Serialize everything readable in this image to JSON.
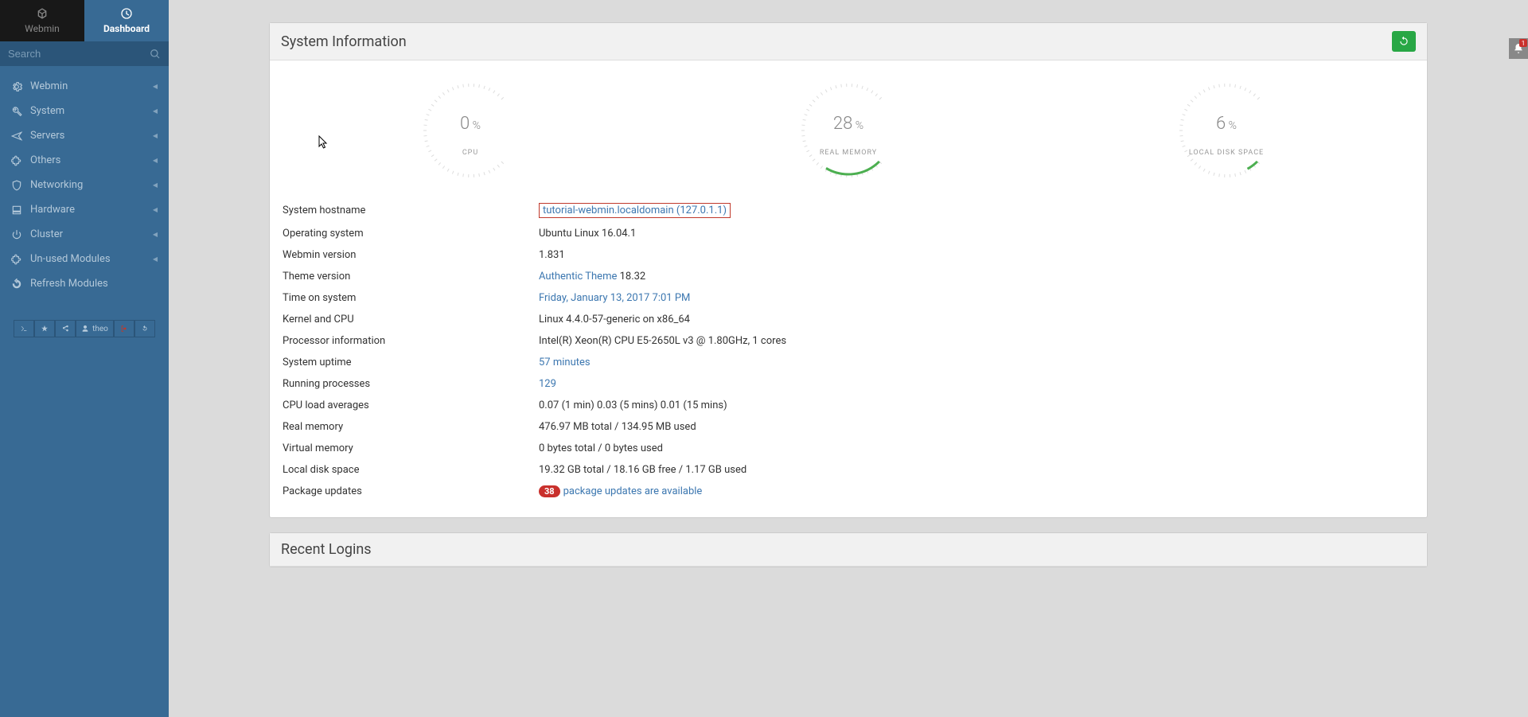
{
  "tabs": {
    "webmin": "Webmin",
    "dashboard": "Dashboard"
  },
  "search": {
    "placeholder": "Search"
  },
  "nav": [
    {
      "label": "Webmin",
      "icon": "gear"
    },
    {
      "label": "System",
      "icon": "wrench"
    },
    {
      "label": "Servers",
      "icon": "plane"
    },
    {
      "label": "Others",
      "icon": "puzzle"
    },
    {
      "label": "Networking",
      "icon": "shield"
    },
    {
      "label": "Hardware",
      "icon": "disk"
    },
    {
      "label": "Cluster",
      "icon": "power"
    },
    {
      "label": "Un-used Modules",
      "icon": "puzzle"
    },
    {
      "label": "Refresh Modules",
      "icon": "refresh",
      "expandable": false
    }
  ],
  "user": "theo",
  "panel_title": "System Information",
  "gauges": {
    "cpu": {
      "value": 0,
      "label": "CPU"
    },
    "mem": {
      "value": 28,
      "label": "REAL MEMORY"
    },
    "disk": {
      "value": 6,
      "label": "LOCAL DISK SPACE"
    }
  },
  "info": {
    "hostname_label": "System hostname",
    "hostname_value": "tutorial-webmin.localdomain (127.0.1.1)",
    "os_label": "Operating system",
    "os_value": "Ubuntu Linux 16.04.1",
    "webminver_label": "Webmin version",
    "webminver_value": "1.831",
    "themever_label": "Theme version",
    "themever_link": "Authentic Theme",
    "themever_value": " 18.32",
    "time_label": "Time on system",
    "time_value": "Friday, January 13, 2017 7:01 PM",
    "kernel_label": "Kernel and CPU",
    "kernel_value": "Linux 4.4.0-57-generic on x86_64",
    "proc_label": "Processor information",
    "proc_value": "Intel(R) Xeon(R) CPU E5-2650L v3 @ 1.80GHz, 1 cores",
    "uptime_label": "System uptime",
    "uptime_value": "57 minutes",
    "procs_label": "Running processes",
    "procs_value": "129",
    "load_label": "CPU load averages",
    "load_value": "0.07 (1 min) 0.03 (5 mins) 0.01 (15 mins)",
    "realmem_label": "Real memory",
    "realmem_value": "476.97 MB total / 134.95 MB used",
    "virtmem_label": "Virtual memory",
    "virtmem_value": "0 bytes total / 0 bytes used",
    "localdisk_label": "Local disk space",
    "localdisk_value": "19.32 GB total / 18.16 GB free / 1.17 GB used",
    "pkg_label": "Package updates",
    "pkg_count": "38",
    "pkg_text": "package updates are available"
  },
  "recent_logins_title": "Recent Logins",
  "notif_count": "1",
  "chart_data": {
    "type": "gauge",
    "series": [
      {
        "name": "CPU",
        "value": 0,
        "unit": "%",
        "range": [
          0,
          100
        ]
      },
      {
        "name": "REAL MEMORY",
        "value": 28,
        "unit": "%",
        "range": [
          0,
          100
        ]
      },
      {
        "name": "LOCAL DISK SPACE",
        "value": 6,
        "unit": "%",
        "range": [
          0,
          100
        ]
      }
    ]
  }
}
